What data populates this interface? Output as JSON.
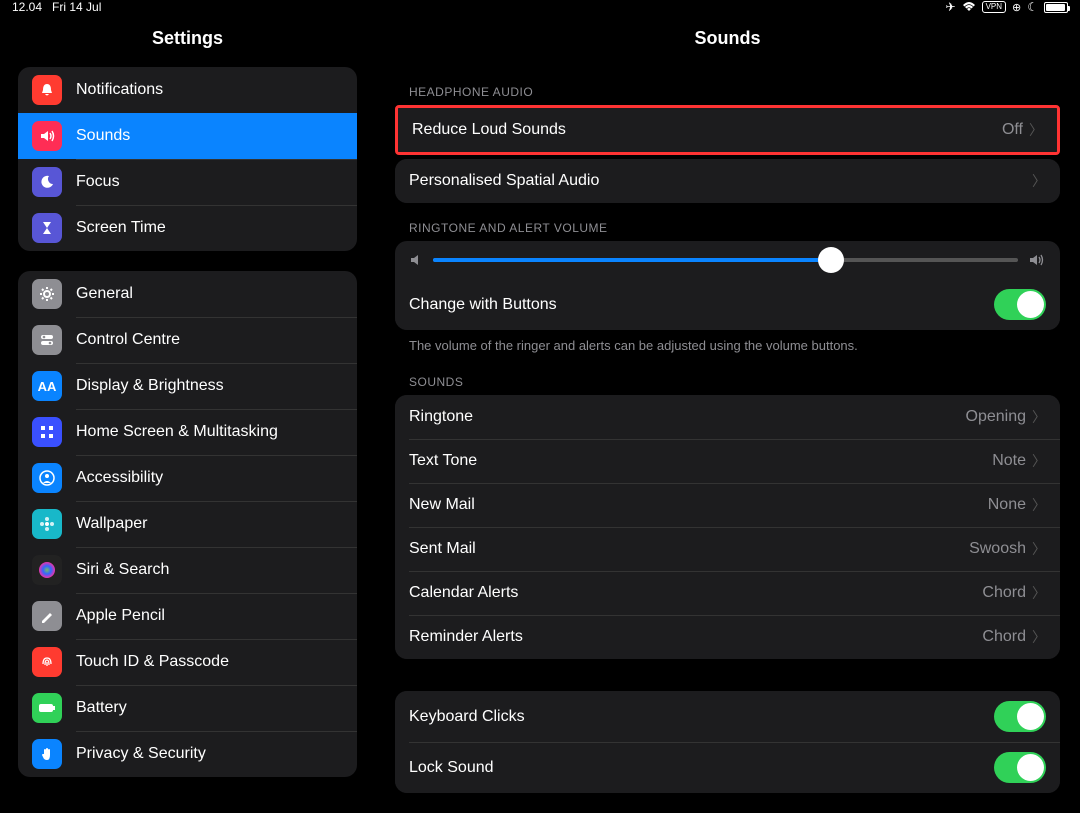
{
  "status": {
    "time": "12.04",
    "date": "Fri 14 Jul",
    "vpn": "VPN"
  },
  "sidebar": {
    "title": "Settings",
    "groups": [
      [
        {
          "label": "Notifications",
          "color": "#ff3b30",
          "icon": "bell"
        },
        {
          "label": "Sounds",
          "color": "#ff2d55",
          "icon": "speaker",
          "selected": true
        },
        {
          "label": "Focus",
          "color": "#5856d6",
          "icon": "moon"
        },
        {
          "label": "Screen Time",
          "color": "#5856d6",
          "icon": "hourglass"
        }
      ],
      [
        {
          "label": "General",
          "color": "#8e8e93",
          "icon": "gear"
        },
        {
          "label": "Control Centre",
          "color": "#8e8e93",
          "icon": "toggles"
        },
        {
          "label": "Display & Brightness",
          "color": "#0a84ff",
          "icon": "aa"
        },
        {
          "label": "Home Screen & Multitasking",
          "color": "#3a50ff",
          "icon": "grid"
        },
        {
          "label": "Accessibility",
          "color": "#0a84ff",
          "icon": "person"
        },
        {
          "label": "Wallpaper",
          "color": "#18b8c9",
          "icon": "flower"
        },
        {
          "label": "Siri & Search",
          "color": "#222",
          "icon": "siri"
        },
        {
          "label": "Apple Pencil",
          "color": "#8e8e93",
          "icon": "pencil"
        },
        {
          "label": "Touch ID & Passcode",
          "color": "#ff3b30",
          "icon": "fingerprint"
        },
        {
          "label": "Battery",
          "color": "#30d158",
          "icon": "battery"
        },
        {
          "label": "Privacy & Security",
          "color": "#0a84ff",
          "icon": "hand"
        }
      ]
    ]
  },
  "detail": {
    "title": "Sounds",
    "headphone_header": "HEADPHONE AUDIO",
    "reduce_loud": {
      "label": "Reduce Loud Sounds",
      "value": "Off"
    },
    "spatial": {
      "label": "Personalised Spatial Audio"
    },
    "ringtone_header": "RINGTONE AND ALERT VOLUME",
    "slider_pct": 68,
    "change_buttons": {
      "label": "Change with Buttons",
      "on": true
    },
    "footer": "The volume of the ringer and alerts can be adjusted using the volume buttons.",
    "sounds_header": "SOUNDS",
    "sounds": [
      {
        "label": "Ringtone",
        "value": "Opening"
      },
      {
        "label": "Text Tone",
        "value": "Note"
      },
      {
        "label": "New Mail",
        "value": "None"
      },
      {
        "label": "Sent Mail",
        "value": "Swoosh"
      },
      {
        "label": "Calendar Alerts",
        "value": "Chord"
      },
      {
        "label": "Reminder Alerts",
        "value": "Chord"
      }
    ],
    "keyboard_clicks": {
      "label": "Keyboard Clicks",
      "on": true
    },
    "lock_sound": {
      "label": "Lock Sound",
      "on": true
    }
  }
}
